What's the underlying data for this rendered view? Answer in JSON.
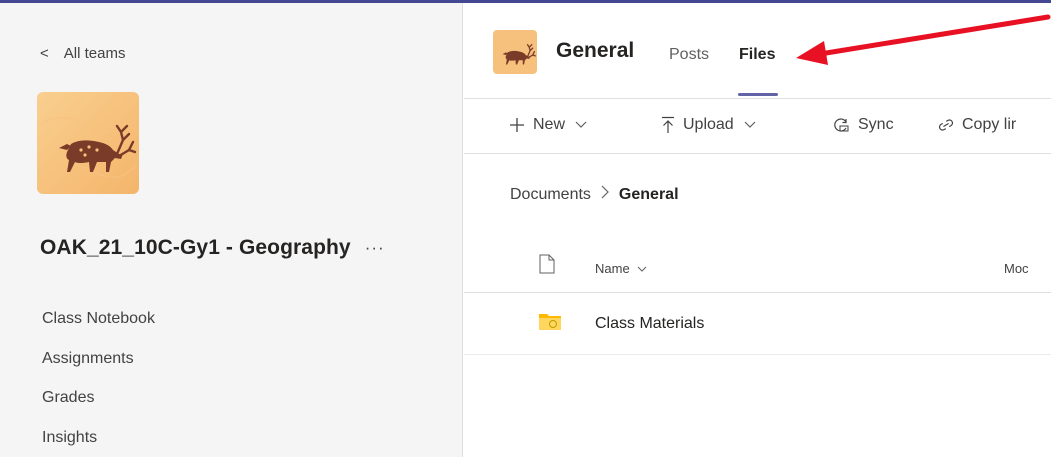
{
  "sidebar": {
    "back_label": "All teams",
    "team_name": "OAK_21_10C-Gy1 - Geography",
    "more_label": "···",
    "items": [
      {
        "label": "Class Notebook"
      },
      {
        "label": "Assignments"
      },
      {
        "label": "Grades"
      },
      {
        "label": "Insights"
      }
    ]
  },
  "channel": {
    "title": "General",
    "tabs": [
      {
        "label": "Posts",
        "selected": false
      },
      {
        "label": "Files",
        "selected": true
      }
    ]
  },
  "toolbar": {
    "new_label": "New",
    "upload_label": "Upload",
    "sync_label": "Sync",
    "copy_label": "Copy lir"
  },
  "breadcrumb": {
    "root": "Documents",
    "current": "General"
  },
  "file_list": {
    "name_header": "Name",
    "modified_header": "Moc",
    "rows": [
      {
        "name": "Class Materials",
        "type": "folder"
      }
    ]
  },
  "colors": {
    "accent": "#6264a7",
    "annotation_arrow": "#e81123",
    "sidebar_bg": "#f5f5f5",
    "avatar_bg": "#f6c17d"
  },
  "icons": {
    "back": "chevron-left-icon",
    "more": "more-icon",
    "new": "plus-icon",
    "upload": "upload-icon",
    "sync": "sync-icon",
    "copy": "link-icon",
    "document": "document-icon",
    "folder": "folder-icon"
  }
}
